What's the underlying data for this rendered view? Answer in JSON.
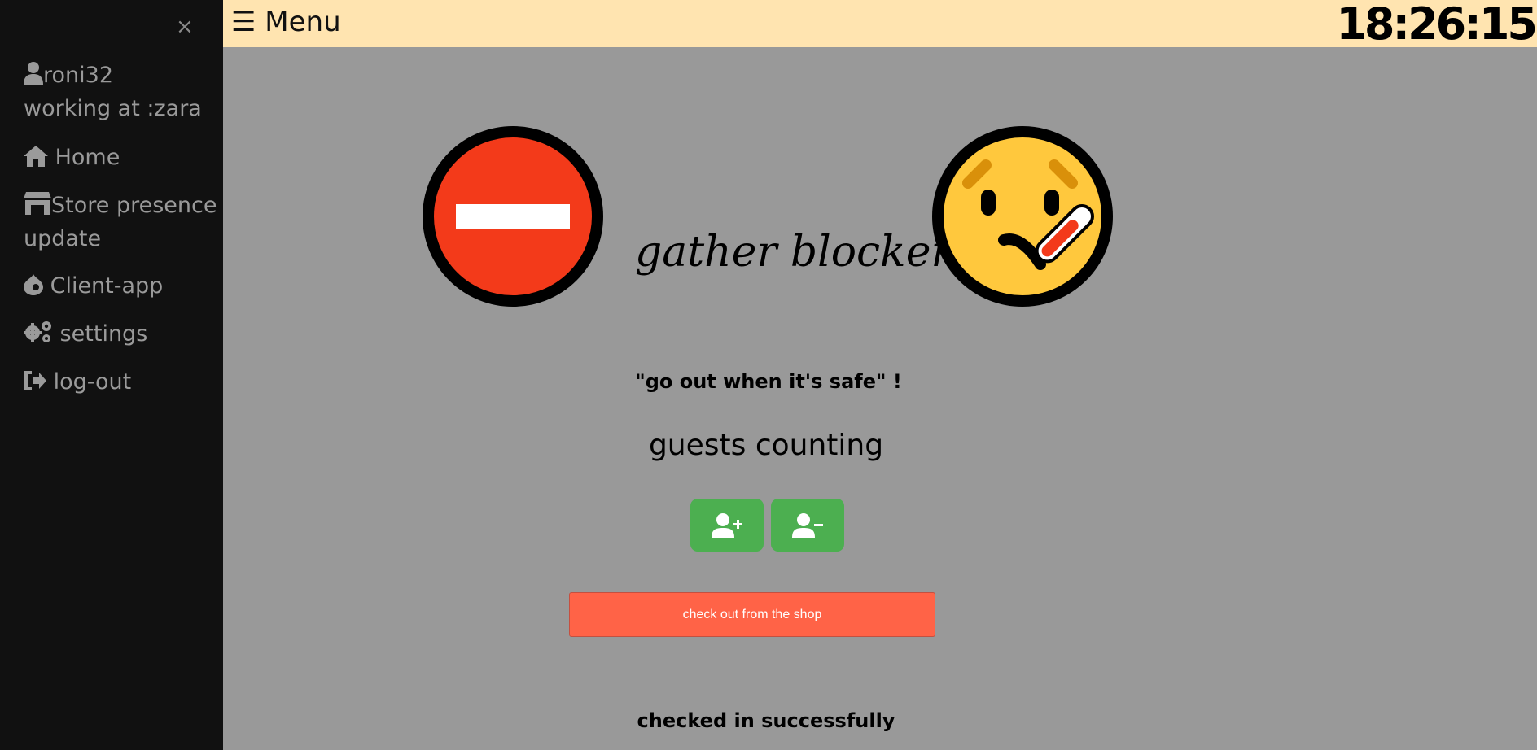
{
  "sidebar": {
    "close_label": "×",
    "username": "roni32",
    "workplace": "working at :zara",
    "items": [
      {
        "label": "Home",
        "icon": "home-icon"
      },
      {
        "label": "Store presence update",
        "icon": "store-icon"
      },
      {
        "label": "Client-app",
        "icon": "drupal-icon"
      },
      {
        "label": "settings",
        "icon": "gears-icon"
      },
      {
        "label": "log-out",
        "icon": "sign-out-icon"
      }
    ]
  },
  "topbar": {
    "menu_label": "☰ Menu",
    "clock": "18:26:15",
    "background": "#ffe4b0"
  },
  "main": {
    "brand_title": "gather blocker",
    "slogan": "\"go out when it's safe\" !",
    "section_title": "guests counting",
    "add_guest_icon": "user-plus-icon",
    "remove_guest_icon": "user-minus-icon",
    "checkout_label": "check out from the shop",
    "status_message": "checked in successfully",
    "colors": {
      "count_button": "#4caf50",
      "checkout_button": "#ff6347",
      "background": "#999999"
    }
  }
}
